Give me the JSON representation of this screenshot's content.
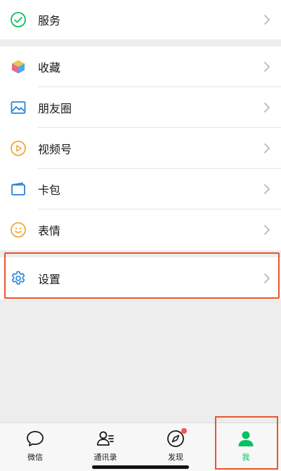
{
  "menu": {
    "services": {
      "label": "服务",
      "icon": "wechat-pay-icon"
    },
    "items": [
      {
        "label": "收藏",
        "icon": "favorites-cube-icon"
      },
      {
        "label": "朋友圈",
        "icon": "moments-picture-icon"
      },
      {
        "label": "视频号",
        "icon": "channels-play-icon"
      },
      {
        "label": "卡包",
        "icon": "card-wallet-icon"
      },
      {
        "label": "表情",
        "icon": "sticker-smile-icon"
      }
    ],
    "settings": {
      "label": "设置",
      "icon": "gear-icon"
    }
  },
  "tabbar": {
    "tabs": [
      {
        "label": "微信",
        "icon": "chat-bubble-icon",
        "active": false
      },
      {
        "label": "通讯录",
        "icon": "contacts-icon",
        "active": false
      },
      {
        "label": "发现",
        "icon": "compass-icon",
        "active": false,
        "badge": "dot"
      },
      {
        "label": "我",
        "icon": "person-icon",
        "active": true
      }
    ]
  },
  "colors": {
    "accent_green": "#07c160",
    "highlight_border": "#e8532c",
    "badge_red": "#fa5151"
  }
}
